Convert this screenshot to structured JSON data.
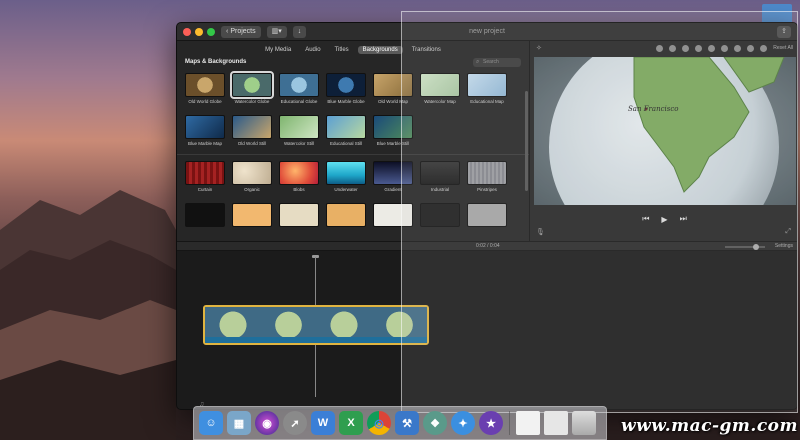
{
  "window": {
    "title": "new project",
    "projects_button": "Projects"
  },
  "browser": {
    "tabs": [
      {
        "label": "My Media",
        "active": false
      },
      {
        "label": "Audio",
        "active": false
      },
      {
        "label": "Titles",
        "active": false
      },
      {
        "label": "Backgrounds",
        "active": true
      },
      {
        "label": "Transitions",
        "active": false
      }
    ],
    "section_title": "Maps & Backgrounds",
    "search_placeholder": "Search",
    "maps_row1": [
      {
        "label": "Old World Globe",
        "selected": false,
        "color": "#8a6d3b"
      },
      {
        "label": "Watercolor Globe",
        "selected": true,
        "color": "#6f8f66"
      },
      {
        "label": "Educational Globe",
        "selected": false,
        "color": "#5c8db0"
      },
      {
        "label": "Blue Marble Globe",
        "selected": false,
        "color": "#1f4b7a"
      },
      {
        "label": "Old World Map",
        "selected": false,
        "color": "#a88852"
      },
      {
        "label": "Watercolor Map",
        "selected": false,
        "color": "#a7c6a0"
      },
      {
        "label": "Educational Map",
        "selected": false,
        "color": "#8fb7d6"
      }
    ],
    "maps_row2": [
      {
        "label": "Blue Marble Map",
        "color": "#1e4470"
      },
      {
        "label": "Old World Still",
        "color": "#9b8050"
      },
      {
        "label": "Watercolor Still",
        "color": "#9fc29a"
      },
      {
        "label": "Educational Still",
        "color": "#7daed3"
      },
      {
        "label": "Blue Marble Still",
        "color": "#1a3f6a"
      }
    ],
    "backgrounds_row1": [
      {
        "label": "Curtain",
        "color": "#8a1a1a"
      },
      {
        "label": "Organic",
        "color": "#d8cbb5"
      },
      {
        "label": "Blobs",
        "color": "#e04d3a"
      },
      {
        "label": "Underwater",
        "color": "#1ea7c9"
      },
      {
        "label": "Gradient",
        "color": "#3a3f6a"
      },
      {
        "label": "Industrial",
        "color": "#2a2a2a"
      },
      {
        "label": "Pinstripes",
        "color": "#8f9096"
      }
    ],
    "backgrounds_row2": [
      {
        "color": "#111111"
      },
      {
        "color": "#f2b86f"
      },
      {
        "color": "#e6dcc3"
      },
      {
        "color": "#e8b065"
      },
      {
        "color": "#ecebe5"
      },
      {
        "color": "#1c1c1c"
      },
      {
        "color": "#a6a6a6"
      }
    ]
  },
  "viewer": {
    "reset_all": "Reset All",
    "map_label": "San Francisco"
  },
  "status": {
    "timecode": "0:02 / 0:04",
    "settings": "Settings"
  },
  "dock": {
    "apps": [
      {
        "name": "Finder",
        "color": "#3f8fe0",
        "glyph": "☺"
      },
      {
        "name": "Preview",
        "color": "#7aa6c9",
        "glyph": "▦"
      },
      {
        "name": "Siri",
        "color": "#5b3f9e",
        "glyph": "◉"
      },
      {
        "name": "Launchpad",
        "color": "#8a8a8a",
        "glyph": "➚"
      },
      {
        "name": "Word",
        "color": "#3b7fd6",
        "glyph": "W"
      },
      {
        "name": "Excel",
        "color": "#2f9e4f",
        "glyph": "X"
      },
      {
        "name": "Chrome",
        "color": "#e8e8e8",
        "glyph": "◎"
      },
      {
        "name": "Xcode",
        "color": "#3a78c9",
        "glyph": "⚒"
      },
      {
        "name": "Preview2",
        "color": "#5a9a8a",
        "glyph": "❖"
      },
      {
        "name": "Safari",
        "color": "#3b8fe0",
        "glyph": "✦"
      },
      {
        "name": "iMovie",
        "color": "#6a3fb0",
        "glyph": "★"
      }
    ],
    "stacks": [
      {
        "name": "Stack1",
        "color": "#f2f2f2"
      },
      {
        "name": "Stack2",
        "color": "#e6e6e6"
      },
      {
        "name": "Trash",
        "color": "#c9c9c9"
      }
    ]
  },
  "watermark": "www.mac-gm.com"
}
